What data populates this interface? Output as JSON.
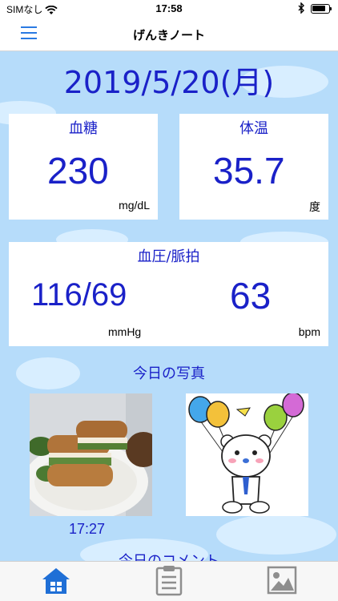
{
  "status_bar": {
    "carrier": "SIMなし",
    "time": "17:58",
    "battery_level": 0.85
  },
  "nav": {
    "title": "げんきノート"
  },
  "date": "2019/5/20(月)",
  "blood_sugar": {
    "label": "血糖",
    "value": "230",
    "unit": "mg/dL"
  },
  "temperature": {
    "label": "体温",
    "value": "35.7",
    "unit": "度"
  },
  "blood_pressure": {
    "label": "血圧/脈拍",
    "pressure_value": "116/69",
    "pressure_unit": "mmHg",
    "pulse_value": "63",
    "pulse_unit": "bpm"
  },
  "photos": {
    "title": "今日の写真",
    "items": [
      {
        "description": "sandwich-photo",
        "time": "17:27"
      },
      {
        "description": "bear-with-balloons-illustration"
      }
    ]
  },
  "comment": {
    "title": "今日のコメント"
  },
  "tabbar": {
    "items": [
      "home-icon",
      "clipboard-icon",
      "image-icon"
    ],
    "accent": "#1f6fd6",
    "inactive": "#8e8e8e"
  },
  "colors": {
    "background": "#b6dcfa",
    "text_accent": "#1a21c8",
    "nav_accent": "#2a7ae2"
  }
}
